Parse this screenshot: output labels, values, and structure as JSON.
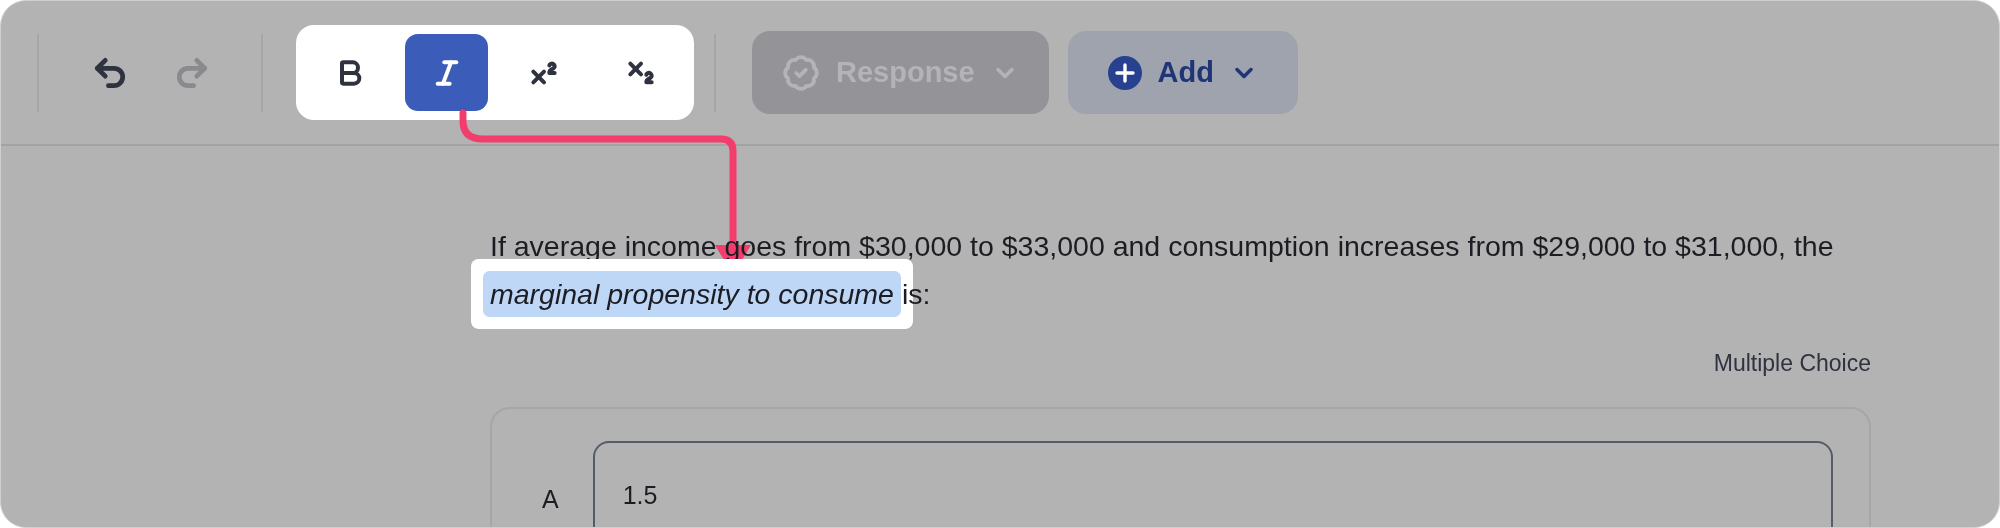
{
  "toolbar": {
    "history": [
      {
        "kind": "undo",
        "disabled": false
      },
      {
        "kind": "redo",
        "disabled": true
      }
    ],
    "format_buttons": [
      {
        "kind": "bold",
        "selected": false
      },
      {
        "kind": "italic",
        "selected": true
      },
      {
        "kind": "superscript",
        "selected": false
      },
      {
        "kind": "subscript",
        "selected": false
      }
    ],
    "response_button": {
      "label": "Response",
      "disabled": true
    },
    "add_button": {
      "label": "Add",
      "disabled": false
    }
  },
  "question": {
    "text": "If average income goes from $30,000 to $33,000 and consumption increases from $29,000 to $31,000, the *marginal propensity to consume* is:",
    "type_label": "Multiple Choice"
  },
  "choices": [
    {
      "letter": "A",
      "value": "1.5"
    }
  ]
}
